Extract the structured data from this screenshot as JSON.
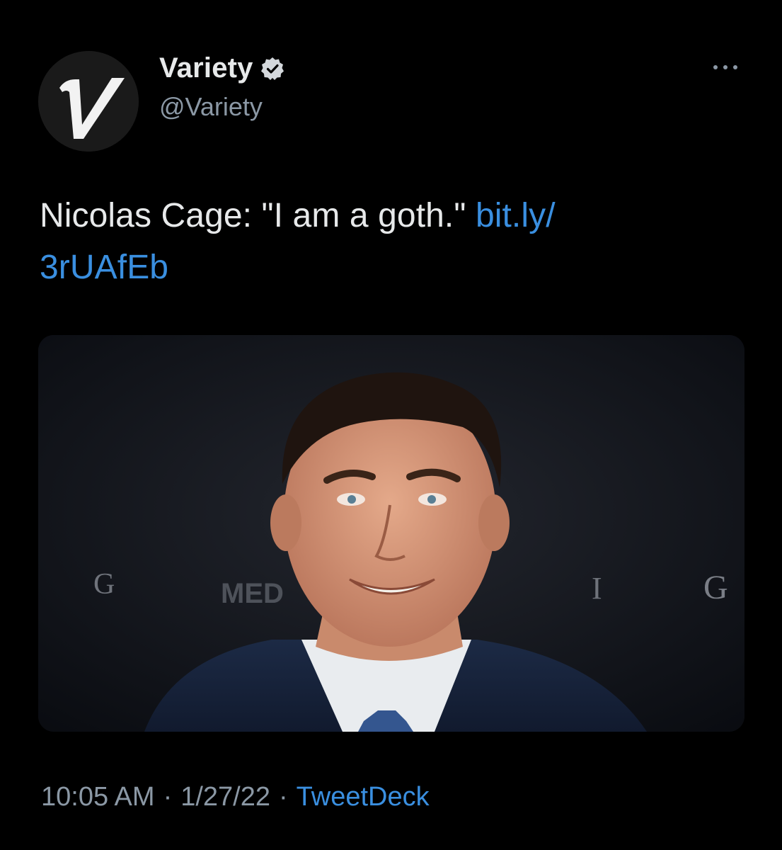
{
  "tweet": {
    "author": {
      "name": "Variety",
      "handle": "@Variety",
      "avatar_icon": "variety-logo-icon",
      "verified_icon": "verified-badge-icon"
    },
    "more_icon": "more-options-icon",
    "text": "Nicolas Cage: \"I am a goth.\"",
    "link_line1": "bit.ly/",
    "link_line2": "3rUAfEb",
    "media": {
      "backdrop_letters": [
        "G",
        "I",
        "G"
      ],
      "backdrop_text": "MED"
    },
    "meta": {
      "time": "10:05 AM",
      "date": "1/27/22",
      "separator": "·",
      "source": "TweetDeck"
    }
  },
  "colors": {
    "background": "#000000",
    "text": "#e7e9ea",
    "secondary": "#8b98a5",
    "link": "#3a8fe0",
    "verified": "#cfd3d7"
  }
}
